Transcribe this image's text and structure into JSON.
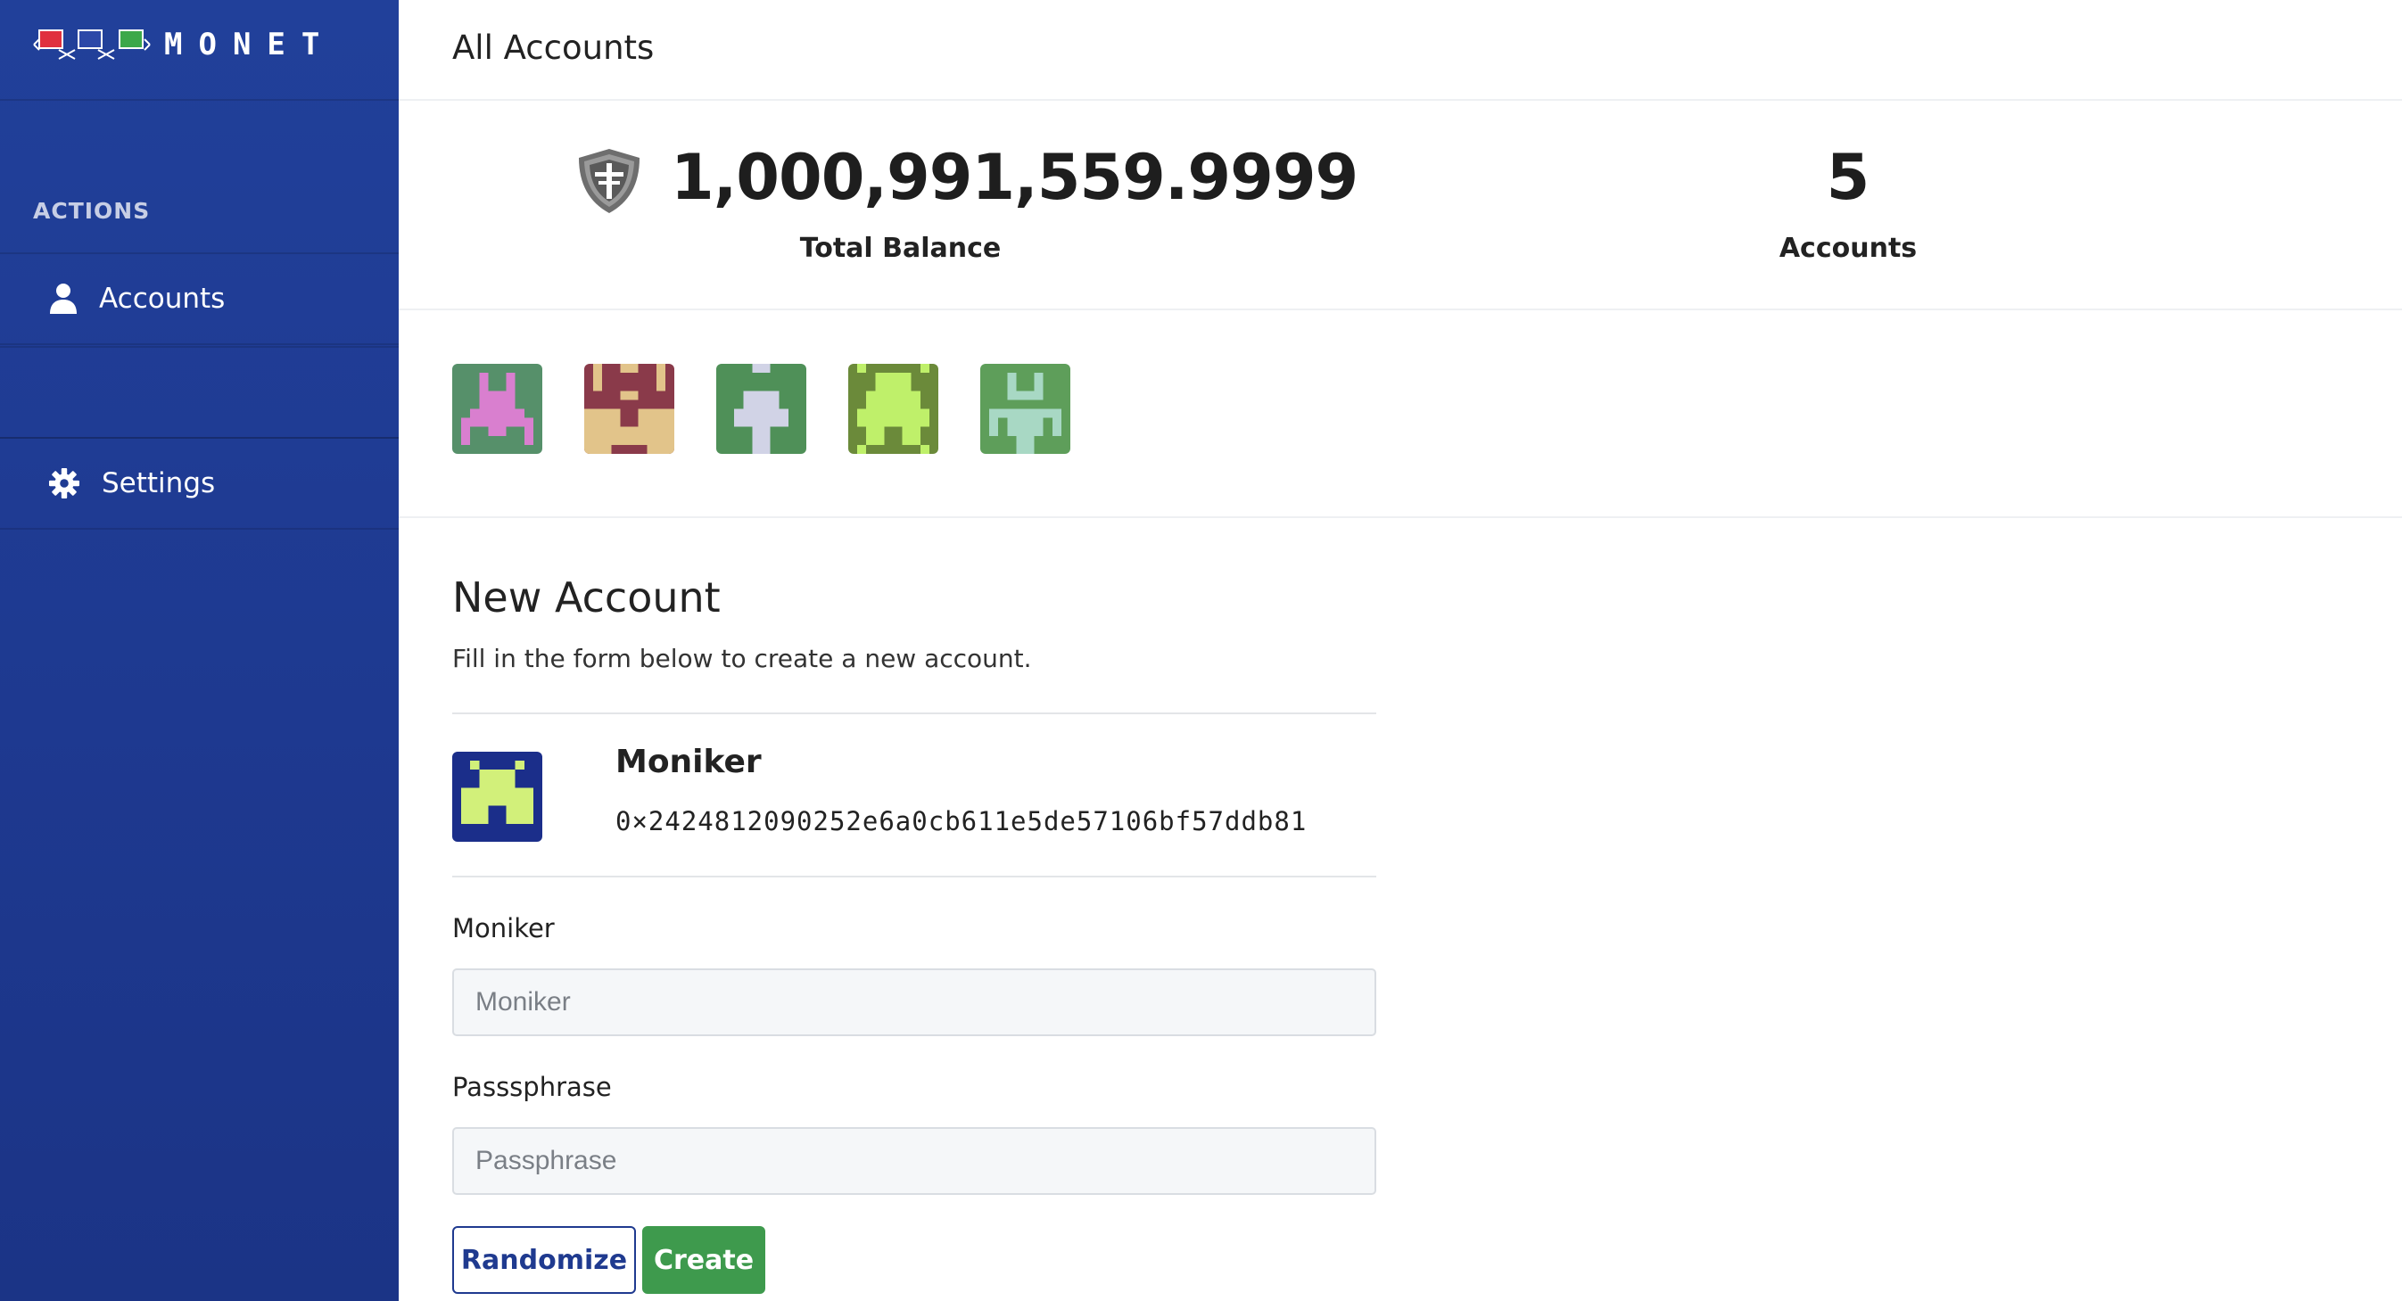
{
  "brand": {
    "name": "MONET"
  },
  "sidebar": {
    "section_label": "ACTIONS",
    "items": [
      {
        "label": "Accounts",
        "icon": "user-icon"
      },
      {
        "label": "Settings",
        "icon": "gear-icon"
      }
    ]
  },
  "header": {
    "title": "All Accounts"
  },
  "stats": {
    "balance_value": "1,000,991,559.9999",
    "balance_label": "Total Balance",
    "accounts_value": "5",
    "accounts_label": "Accounts"
  },
  "account_avatars": [
    {
      "icon": "account-avatar-icon",
      "colors": [
        "#56906a",
        "#d97fcf"
      ]
    },
    {
      "icon": "account-avatar-icon",
      "colors": [
        "#8a3a4a",
        "#e2c48a"
      ]
    },
    {
      "icon": "account-avatar-icon",
      "colors": [
        "#4f9058",
        "#d1d3e6"
      ]
    },
    {
      "icon": "account-avatar-icon",
      "colors": [
        "#6b8a3a",
        "#bff06a"
      ]
    },
    {
      "icon": "account-avatar-icon",
      "colors": [
        "#5e9e5a",
        "#a8d8c4"
      ]
    }
  ],
  "new_account": {
    "title": "New Account",
    "subtitle": "Fill in the form below to create a new account.",
    "preview": {
      "name": "Moniker",
      "address": "0×2424812090252e6a0cb611e5de57106bf57ddb81",
      "colors": [
        "#1b2e8a",
        "#d2f07a"
      ]
    },
    "moniker_label": "Moniker",
    "moniker_placeholder": "Moniker",
    "passphrase_label": "Passsphrase",
    "passphrase_placeholder": "Passphrase",
    "randomize_label": "Randomize",
    "create_label": "Create"
  },
  "colors": {
    "sidebar": "#1e3990",
    "primary": "#1f3a8f",
    "success": "#3e9a4d"
  }
}
